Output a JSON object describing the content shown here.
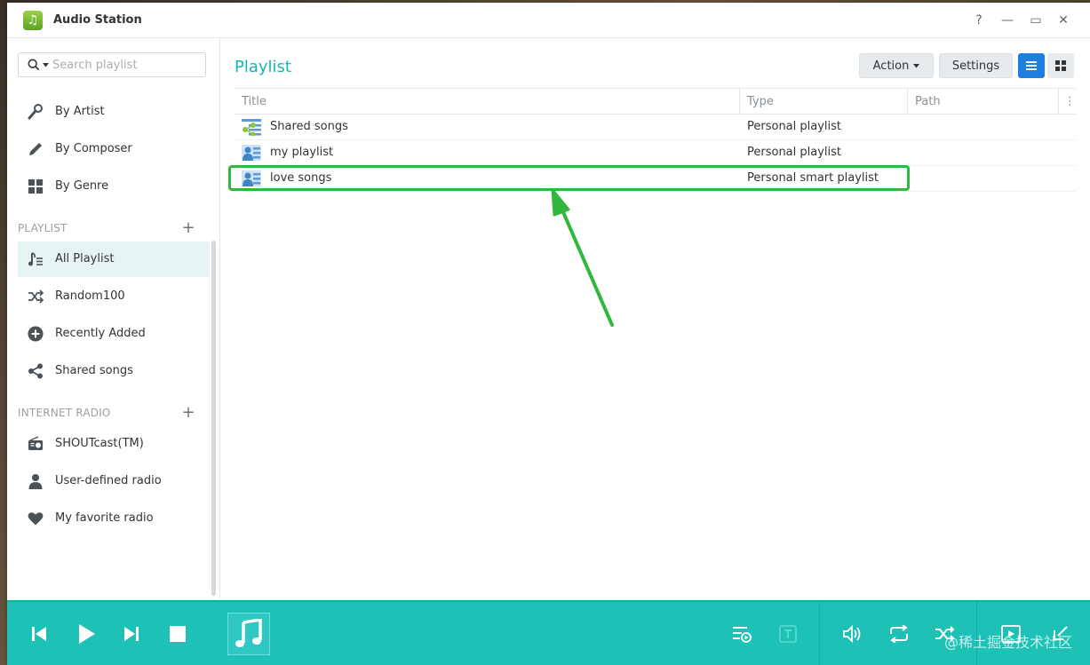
{
  "window": {
    "title": "Audio Station",
    "controls": {
      "help": "?",
      "minimize": "—",
      "maximize": "▭",
      "close": "✕"
    }
  },
  "sidebar": {
    "search_placeholder": "Search playlist",
    "library": [
      {
        "label": "By Artist",
        "icon": "microphone-icon"
      },
      {
        "label": "By Composer",
        "icon": "pen-icon"
      },
      {
        "label": "By Genre",
        "icon": "grid-icon"
      }
    ],
    "playlist_section": "PLAYLIST",
    "playlists": [
      {
        "label": "All Playlist",
        "icon": "playlist-icon",
        "active": true
      },
      {
        "label": "Random100",
        "icon": "shuffle-icon"
      },
      {
        "label": "Recently Added",
        "icon": "plus-circle-icon"
      },
      {
        "label": "Shared songs",
        "icon": "share-icon"
      }
    ],
    "radio_section": "INTERNET RADIO",
    "radios": [
      {
        "label": "SHOUTcast(TM)",
        "icon": "radio-icon"
      },
      {
        "label": "User-defined radio",
        "icon": "user-icon"
      },
      {
        "label": "My favorite radio",
        "icon": "heart-icon"
      }
    ]
  },
  "main": {
    "title": "Playlist",
    "action_label": "Action",
    "settings_label": "Settings",
    "columns": [
      "Title",
      "Type",
      "Path"
    ],
    "rows": [
      {
        "title": "Shared songs",
        "type": "Personal playlist",
        "icon": "shared-playlist-icon"
      },
      {
        "title": "my playlist",
        "type": "Personal playlist",
        "icon": "personal-playlist-icon"
      },
      {
        "title": "love songs",
        "type": "Personal smart playlist",
        "icon": "smart-playlist-icon"
      }
    ]
  },
  "colors": {
    "accent": "#1ab3b8",
    "player": "#1ec1b6",
    "highlight": "#2fb83b",
    "view_active": "#1f7fe0"
  },
  "watermark": "@稀土掘金技术社区"
}
